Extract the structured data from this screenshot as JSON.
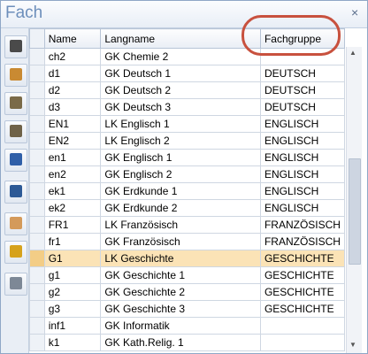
{
  "window": {
    "title": "Fach",
    "close_glyph": "×"
  },
  "sidebar": {
    "buttons": [
      {
        "icon": "graduation-cap-icon",
        "color": "#4a4a4a"
      },
      {
        "icon": "people-icon",
        "color": "#c98a32"
      },
      {
        "icon": "door-icon",
        "color": "#7a6a48"
      },
      {
        "icon": "doors-icon",
        "color": "#6f6248"
      },
      {
        "icon": "book-icon",
        "color": "#2f5fa8"
      },
      {
        "icon": "books-icon",
        "color": "#2d5a96"
      },
      {
        "icon": "person-icon",
        "color": "#d49a5a"
      },
      {
        "icon": "dollar-icon",
        "color": "#d6a21c"
      },
      {
        "icon": "list-icon",
        "color": "#7d8896"
      }
    ]
  },
  "table": {
    "columns": [
      "Name",
      "Langname",
      "Fachgruppe"
    ],
    "selected_index": 12,
    "rows": [
      [
        "ch2",
        "GK Chemie 2",
        ""
      ],
      [
        "d1",
        "GK Deutsch 1",
        "DEUTSCH"
      ],
      [
        "d2",
        "GK Deutsch 2",
        "DEUTSCH"
      ],
      [
        "d3",
        "GK Deutsch 3",
        "DEUTSCH"
      ],
      [
        "EN1",
        "LK Englisch 1",
        "ENGLISCH"
      ],
      [
        "EN2",
        "LK Englisch 2",
        "ENGLISCH"
      ],
      [
        "en1",
        "GK Englisch 1",
        "ENGLISCH"
      ],
      [
        "en2",
        "GK Englisch 2",
        "ENGLISCH"
      ],
      [
        "ek1",
        "GK Erdkunde 1",
        "ENGLISCH"
      ],
      [
        "ek2",
        "GK Erdkunde 2",
        "ENGLISCH"
      ],
      [
        "FR1",
        "LK Französisch",
        "FRANZÖSISCH"
      ],
      [
        "fr1",
        "GK Französisch",
        "FRANZÖSISCH"
      ],
      [
        "G1",
        "LK Geschichte",
        "GESCHICHTE"
      ],
      [
        "g1",
        "GK Geschichte 1",
        "GESCHICHTE"
      ],
      [
        "g2",
        "GK Geschichte 2",
        "GESCHICHTE"
      ],
      [
        "g3",
        "GK Geschichte 3",
        "GESCHICHTE"
      ],
      [
        "inf1",
        "GK Informatik",
        ""
      ],
      [
        "k1",
        "GK Kath.Relig. 1",
        ""
      ]
    ]
  },
  "annotation": {
    "color": "#c8513e"
  }
}
